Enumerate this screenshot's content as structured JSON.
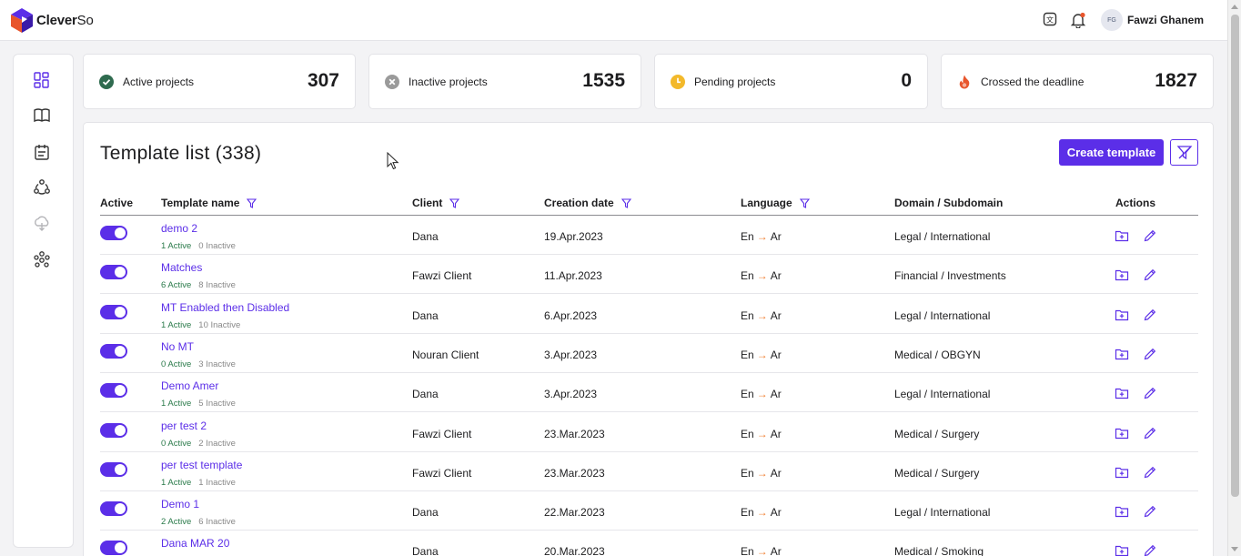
{
  "app": {
    "name_bold": "Clever",
    "name_light": "So"
  },
  "user": {
    "initials": "FG",
    "name": "Fawzi Ghanem"
  },
  "stats": [
    {
      "label": "Active projects",
      "value": "307",
      "icon": "check-circle-icon",
      "color": "#2f6b4f"
    },
    {
      "label": "Inactive projects",
      "value": "1535",
      "icon": "x-circle-icon",
      "color": "#9a9a9a"
    },
    {
      "label": "Pending projects",
      "value": "0",
      "icon": "clock-icon",
      "color": "#f3b92b"
    },
    {
      "label": "Crossed the deadline",
      "value": "1827",
      "icon": "flame-icon",
      "color": "#e8552c"
    }
  ],
  "list": {
    "title": "Template list (338)",
    "create_label": "Create template",
    "columns": {
      "active": "Active",
      "template_name": "Template name",
      "client": "Client",
      "creation_date": "Creation date",
      "language": "Language",
      "domain": "Domain / Subdomain",
      "actions": "Actions"
    },
    "rows": [
      {
        "name": "demo 2",
        "active": "1 Active",
        "inactive": "0 Inactive",
        "client": "Dana",
        "date": "19.Apr.2023",
        "src": "En",
        "tgt": "Ar",
        "domain": "Legal / International"
      },
      {
        "name": "Matches",
        "active": "6 Active",
        "inactive": "8 Inactive",
        "client": "Fawzi Client",
        "date": "11.Apr.2023",
        "src": "En",
        "tgt": "Ar",
        "domain": "Financial / Investments"
      },
      {
        "name": "MT Enabled then Disabled",
        "active": "1 Active",
        "inactive": "10 Inactive",
        "client": "Dana",
        "date": "6.Apr.2023",
        "src": "En",
        "tgt": "Ar",
        "domain": "Legal / International"
      },
      {
        "name": "No MT",
        "active": "0 Active",
        "inactive": "3 Inactive",
        "client": "Nouran Client",
        "date": "3.Apr.2023",
        "src": "En",
        "tgt": "Ar",
        "domain": "Medical / OBGYN"
      },
      {
        "name": "Demo Amer",
        "active": "1 Active",
        "inactive": "5 Inactive",
        "client": "Dana",
        "date": "3.Apr.2023",
        "src": "En",
        "tgt": "Ar",
        "domain": "Legal / International"
      },
      {
        "name": "per test 2",
        "active": "0 Active",
        "inactive": "2 Inactive",
        "client": "Fawzi Client",
        "date": "23.Mar.2023",
        "src": "En",
        "tgt": "Ar",
        "domain": "Medical / Surgery"
      },
      {
        "name": "per test template",
        "active": "1 Active",
        "inactive": "1 Inactive",
        "client": "Fawzi Client",
        "date": "23.Mar.2023",
        "src": "En",
        "tgt": "Ar",
        "domain": "Medical / Surgery"
      },
      {
        "name": "Demo 1",
        "active": "2 Active",
        "inactive": "6 Inactive",
        "client": "Dana",
        "date": "22.Mar.2023",
        "src": "En",
        "tgt": "Ar",
        "domain": "Legal / International"
      },
      {
        "name": "Dana MAR 20",
        "active": "",
        "inactive": "",
        "client": "Dana",
        "date": "20.Mar.2023",
        "src": "En",
        "tgt": "Ar",
        "domain": "Medical / Smoking"
      }
    ]
  }
}
